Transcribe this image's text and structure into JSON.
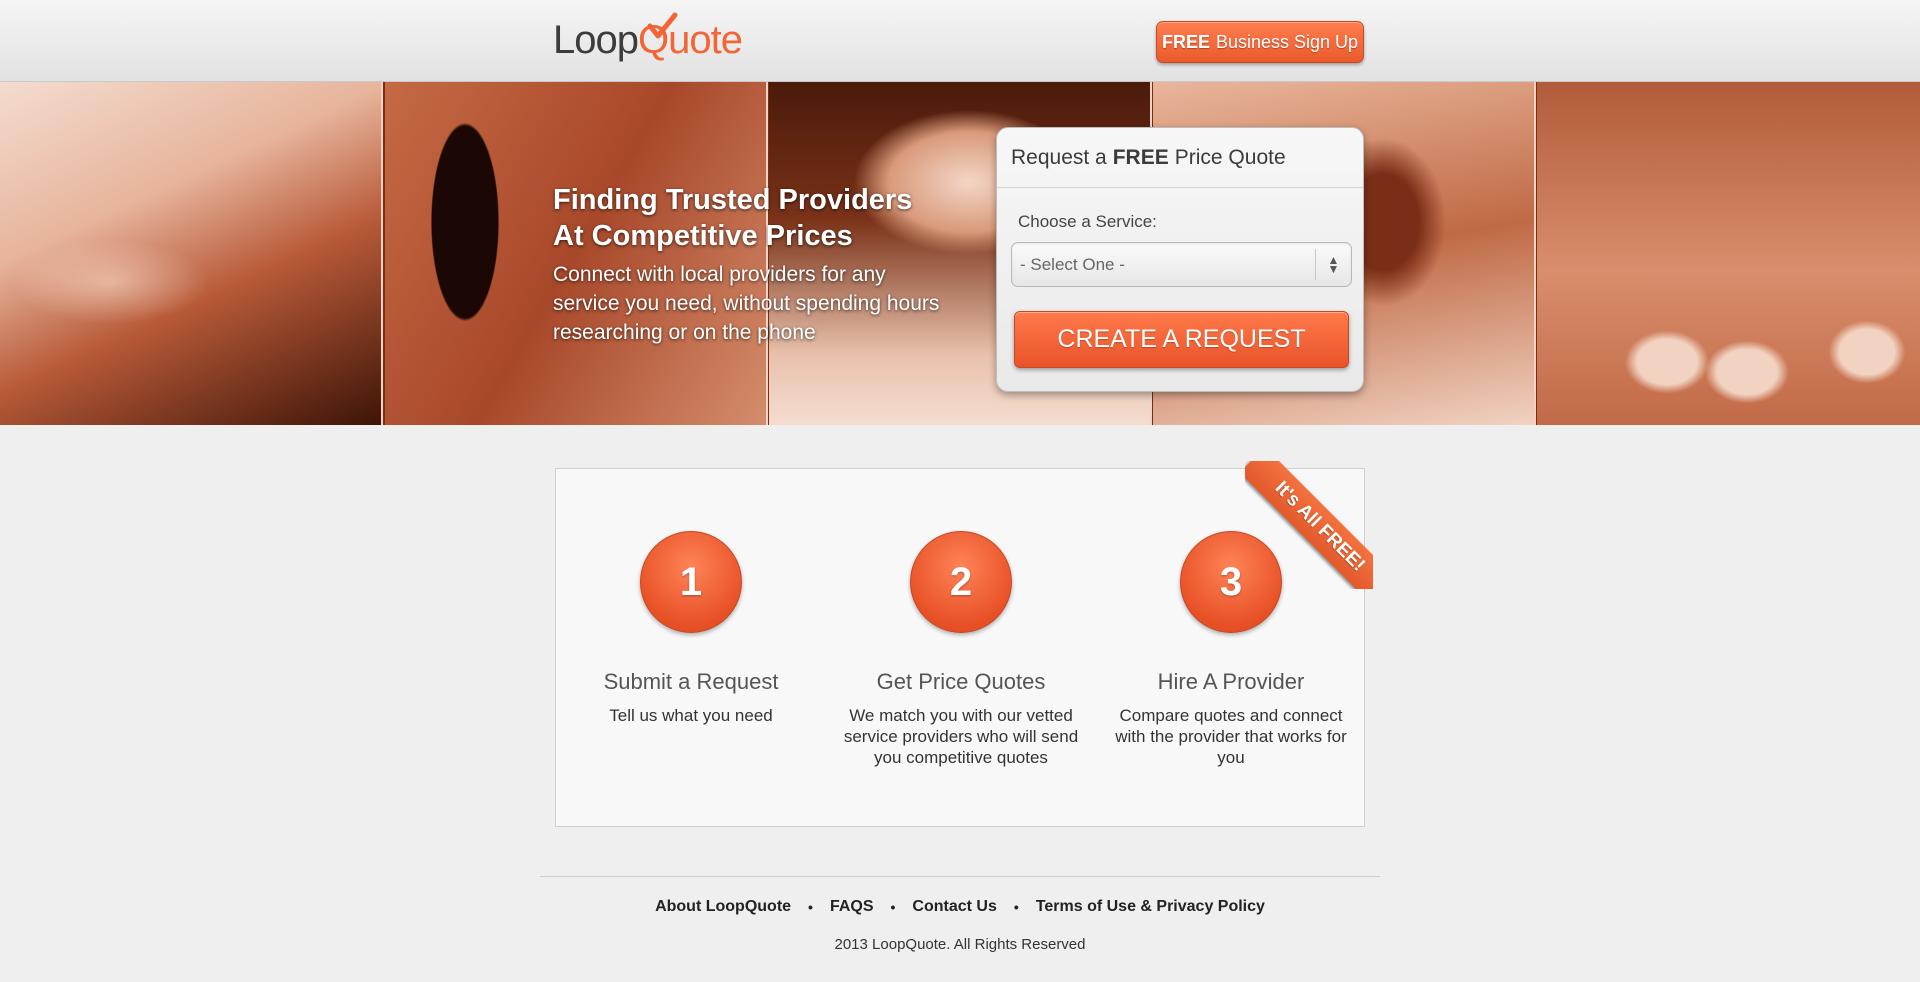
{
  "header": {
    "logo": {
      "part1": "Loop",
      "part2": "Q",
      "part3": "uote"
    },
    "signup": {
      "free": "FREE",
      "label": "Business Sign Up"
    }
  },
  "hero": {
    "title_line1": "Finding Trusted Providers",
    "title_line2": "At Competitive Prices",
    "subtitle": "Connect with local providers for any service you need, without spending hours researching or on the phone"
  },
  "quote_form": {
    "title_prefix": "Request a",
    "title_emphasis": "FREE",
    "title_suffix": "Price Quote",
    "service_label": "Choose a Service:",
    "service_selected": "- Select One -",
    "submit_label": "CREATE A REQUEST"
  },
  "ribbon": "It's All FREE!",
  "steps": [
    {
      "number": "1",
      "title": "Submit a Request",
      "description": "Tell us what you need"
    },
    {
      "number": "2",
      "title": "Get Price Quotes",
      "description": "We match you with our vetted service providers who will send you competitive quotes"
    },
    {
      "number": "3",
      "title": "Hire A Provider",
      "description": "Compare quotes and connect with the provider that works for you"
    }
  ],
  "footer": {
    "links": [
      "About LoopQuote",
      "FAQS",
      "Contact Us",
      "Terms of Use & Privacy Policy"
    ],
    "separator": "•",
    "copyright": "2013 LoopQuote. All Rights Reserved"
  },
  "colors": {
    "accent": "#f26536",
    "text": "#333333",
    "background": "#efefef"
  }
}
